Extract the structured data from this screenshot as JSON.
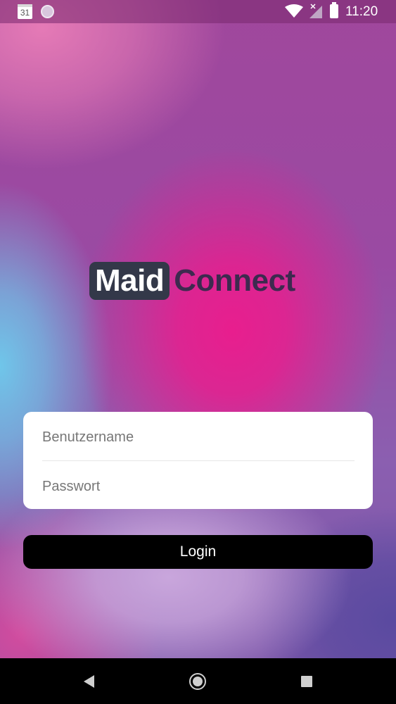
{
  "status_bar": {
    "calendar_day": "31",
    "time": "11:20",
    "icons": [
      "calendar-icon",
      "sync-icon",
      "wifi-icon",
      "signal-icon",
      "battery-icon"
    ]
  },
  "logo": {
    "part1": "Maid",
    "part2": "Connect"
  },
  "form": {
    "username_placeholder": "Benutzername",
    "password_placeholder": "Passwort",
    "login_label": "Login"
  },
  "nav_bar": {
    "icons": [
      "back-icon",
      "home-icon",
      "recents-icon"
    ]
  },
  "colors": {
    "logo_dark": "#333849",
    "logo_text": "#3d2a4f",
    "accent_pink": "#e81e8e",
    "button_bg": "#000000"
  }
}
